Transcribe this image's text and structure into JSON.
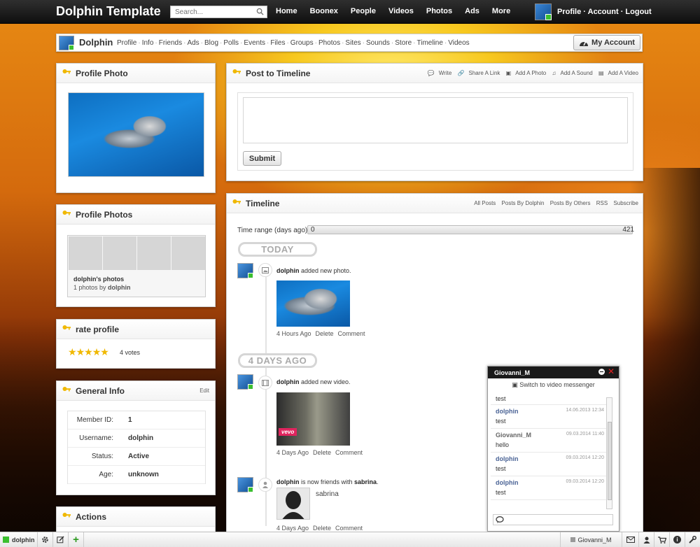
{
  "site": {
    "title": "Dolphin Template"
  },
  "search": {
    "placeholder": "Search..."
  },
  "topnav": [
    "Home",
    "Boonex",
    "People",
    "Videos",
    "Photos",
    "Ads",
    "More"
  ],
  "user_links": {
    "profile": "Profile",
    "account": "Account",
    "logout": "Logout",
    "sep": "·"
  },
  "profile_bar": {
    "name": "Dolphin",
    "items": [
      "Profile",
      "Info",
      "Friends",
      "Ads",
      "Blog",
      "Polls",
      "Events",
      "Files",
      "Groups",
      "Photos",
      "Sites",
      "Sounds",
      "Store",
      "Timeline",
      "Videos"
    ],
    "sep": "·",
    "my_account": "My Account"
  },
  "profile_photo": {
    "title": "Profile Photo"
  },
  "profile_photos": {
    "title": "Profile Photos",
    "album": "dolphin's photos",
    "count_prefix": "1 photos by ",
    "owner": "dolphin"
  },
  "rate": {
    "title": "rate profile",
    "stars": 5,
    "votes": "4 votes"
  },
  "general_info": {
    "title": "General Info",
    "edit": "Edit",
    "rows": [
      {
        "label": "Member ID:",
        "value": "1"
      },
      {
        "label": "Username:",
        "value": "dolphin"
      },
      {
        "label": "Status:",
        "value": "Active"
      },
      {
        "label": "Age:",
        "value": "unknown"
      }
    ]
  },
  "actions": {
    "title": "Actions"
  },
  "post": {
    "title": "Post to Timeline",
    "links": [
      "Write",
      "Share A Link",
      "Add A Photo",
      "Add A Sound",
      "Add A Video"
    ],
    "submit": "Submit"
  },
  "timeline": {
    "title": "Timeline",
    "links": [
      "All Posts",
      "Posts By Dolphin",
      "Posts By Others",
      "RSS",
      "Subscribe"
    ],
    "range_label": "Time range (days ago):",
    "range_min": "0",
    "range_max": "421",
    "day1": "TODAY",
    "day2": "4 DAYS AGO",
    "events": [
      {
        "user": "dolphin",
        "text": " added new photo.",
        "time": "4 Hours Ago"
      },
      {
        "user": "dolphin",
        "text": " added new video.",
        "time": "4 Days Ago"
      },
      {
        "user": "dolphin",
        "text": " is now friends with ",
        "friend": "sabrina",
        "end": ".",
        "time": "4 Days Ago"
      }
    ],
    "delete": "Delete",
    "comment": "Comment",
    "video_brand": "vevo"
  },
  "chat": {
    "title": "Giovanni_M",
    "switch": "Switch to video messenger",
    "top_msg": "test",
    "messages": [
      {
        "user": "dolphin",
        "date": "14.06.2013 12:34",
        "text": "test"
      },
      {
        "user": "Giovanni_M",
        "date": "09.03.2014 11:40",
        "text": "hello"
      },
      {
        "user": "dolphin",
        "date": "09.03.2014 12:20",
        "text": "test"
      },
      {
        "user": "dolphin",
        "date": "09.03.2014 12:20",
        "text": "test"
      }
    ]
  },
  "bottom": {
    "user": "dolphin",
    "chat_tab": "Giovanni_M"
  },
  "colors": {
    "accent": "#f0b800",
    "online": "#3bbf2f",
    "link": "#4b6496"
  }
}
